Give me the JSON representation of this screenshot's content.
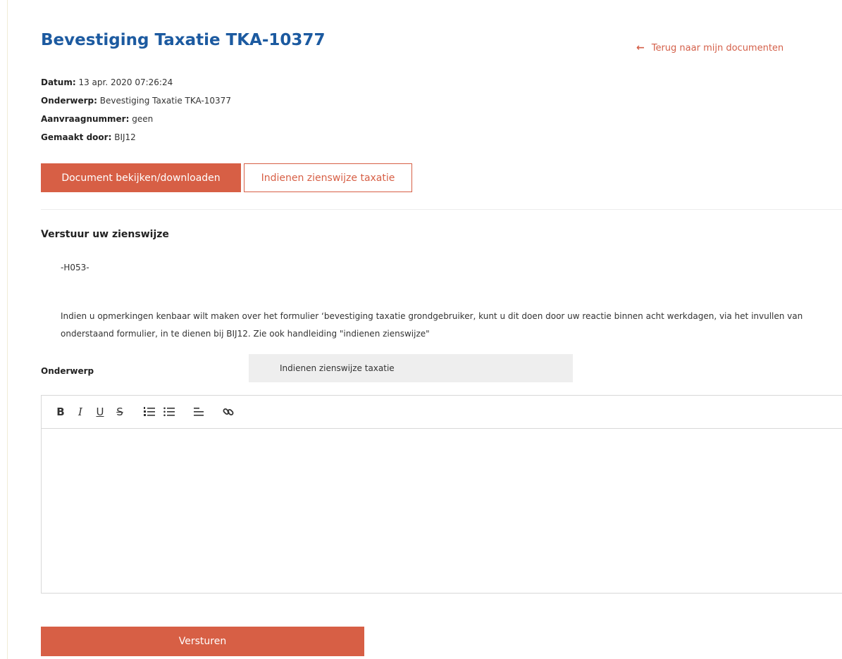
{
  "document": {
    "title": "Bevestiging Taxatie TKA-10377",
    "back_link": "Terug naar mijn documenten",
    "meta": [
      {
        "label": "Datum:",
        "value": "13 apr. 2020 07:26:24"
      },
      {
        "label": "Onderwerp:",
        "value": "Bevestiging Taxatie TKA-10377"
      },
      {
        "label": "Aanvraagnummer:",
        "value": "geen"
      },
      {
        "label": "Gemaakt door:",
        "value": "BIJ12"
      }
    ],
    "actions": {
      "download_label": "Document bekijken/downloaden",
      "submit_view_label": "Indienen zienswijze taxatie"
    }
  },
  "form": {
    "heading": "Verstuur uw zienswijze",
    "code": "-H053-",
    "intro": "Indien u opmerkingen kenbaar wilt maken over het formulier ‘bevestiging taxatie grondgebruiker, kunt u dit doen door uw reactie binnen acht werkdagen, via het invullen van onderstaand formulier, in te dienen bij BIJ12. Zie ook handleiding \"indienen zienswijze\"",
    "subject_label": "Onderwerp",
    "subject_value": "Indienen zienswijze taxatie",
    "toolbar": [
      {
        "name": "bold-icon",
        "glyph": "B"
      },
      {
        "name": "italic-icon",
        "glyph": "I"
      },
      {
        "name": "underline-icon",
        "glyph": "U"
      },
      {
        "name": "strikethrough-icon",
        "glyph": "S"
      },
      {
        "name": "ordered-list-icon",
        "glyph": "⁝≡"
      },
      {
        "name": "bullet-list-icon",
        "glyph": "⁝≡"
      },
      {
        "name": "align-icon",
        "glyph": "☰"
      },
      {
        "name": "link-icon",
        "glyph": "🔗"
      }
    ],
    "send_label": "Versturen"
  },
  "colors": {
    "accent": "#d75f45",
    "title": "#1c5aa0"
  }
}
